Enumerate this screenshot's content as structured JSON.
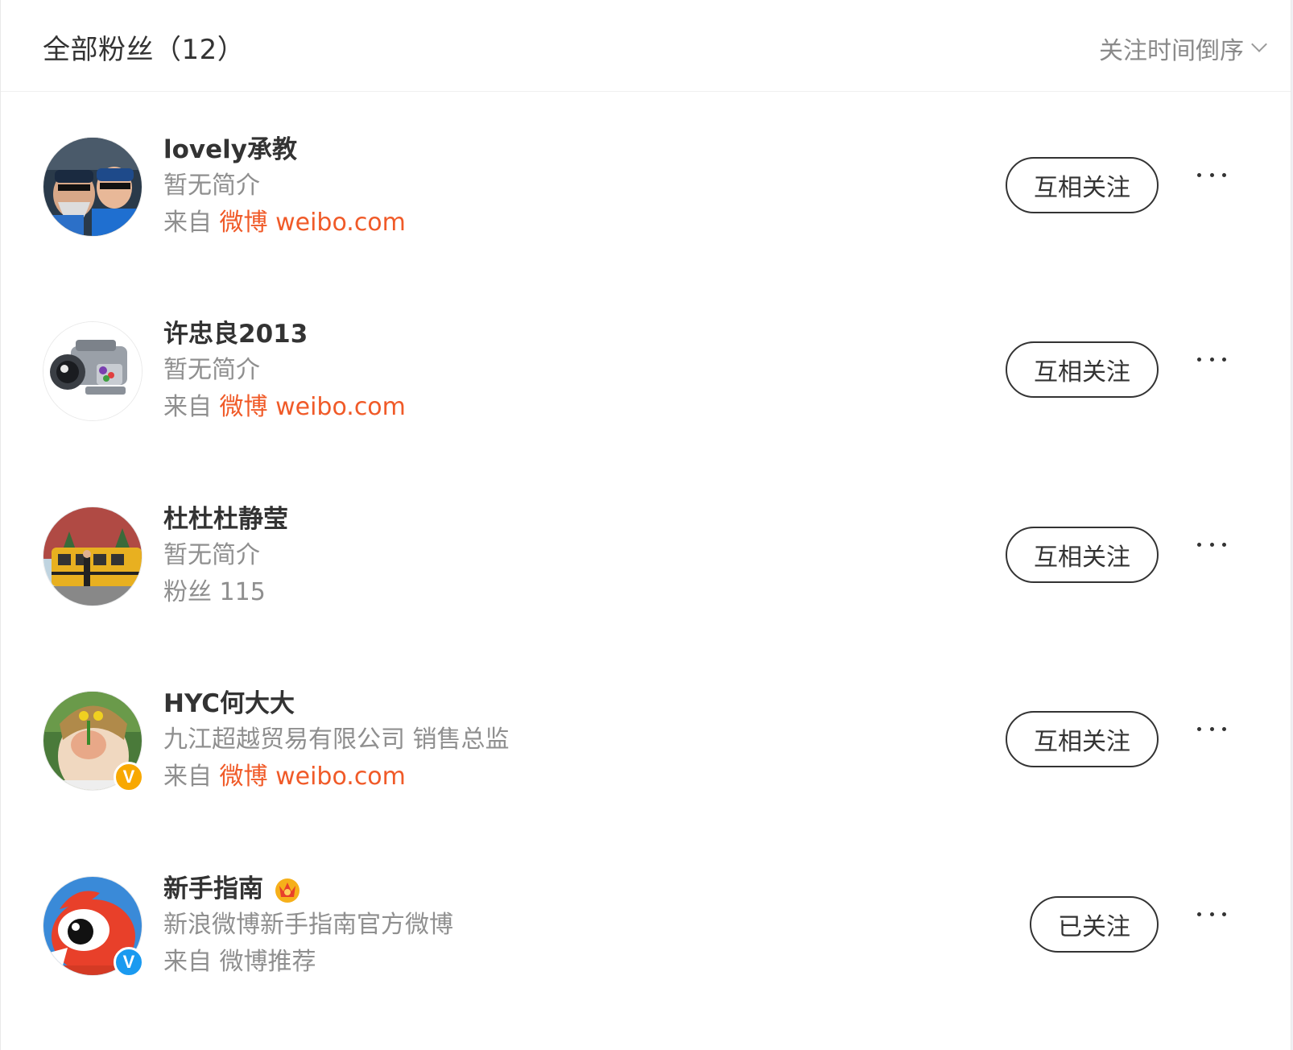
{
  "header": {
    "title": "全部粉丝（12）",
    "sort_label": "关注时间倒序"
  },
  "fans": [
    {
      "name": "lovely承教",
      "bio": "暂无简介",
      "meta_prefix": "来自",
      "meta_value": "微博 weibo.com",
      "button": "互相关注",
      "avatar": "avatar-two-men-in-sunglasses",
      "badge": ""
    },
    {
      "name": "许忠良2013",
      "bio": "暂无简介",
      "meta_prefix": "来自",
      "meta_value": "微博 weibo.com",
      "button": "互相关注",
      "avatar": "avatar-camcorder",
      "badge": ""
    },
    {
      "name": "杜杜杜静莹",
      "bio": "暂无简介",
      "meta_prefix": "粉丝",
      "meta_value": "115",
      "button": "互相关注",
      "avatar": "avatar-school-bus",
      "badge": ""
    },
    {
      "name": "HYC何大大",
      "bio": "九江超越贸易有限公司 销售总监",
      "meta_prefix": "来自",
      "meta_value": "微博 weibo.com",
      "button": "互相关注",
      "avatar": "avatar-child-with-flower",
      "badge": "V"
    },
    {
      "name": "新手指南",
      "bio": "新浪微博新手指南官方微博",
      "meta_prefix": "来自",
      "meta_value": "微博推荐",
      "button": "已关注",
      "avatar": "avatar-weibo-mascot",
      "badge": "V"
    }
  ],
  "colors": {
    "accent": "#f05a28",
    "muted": "#8f8f8f",
    "badge_gold": "#f8a800",
    "badge_blue": "#1a9af0"
  }
}
